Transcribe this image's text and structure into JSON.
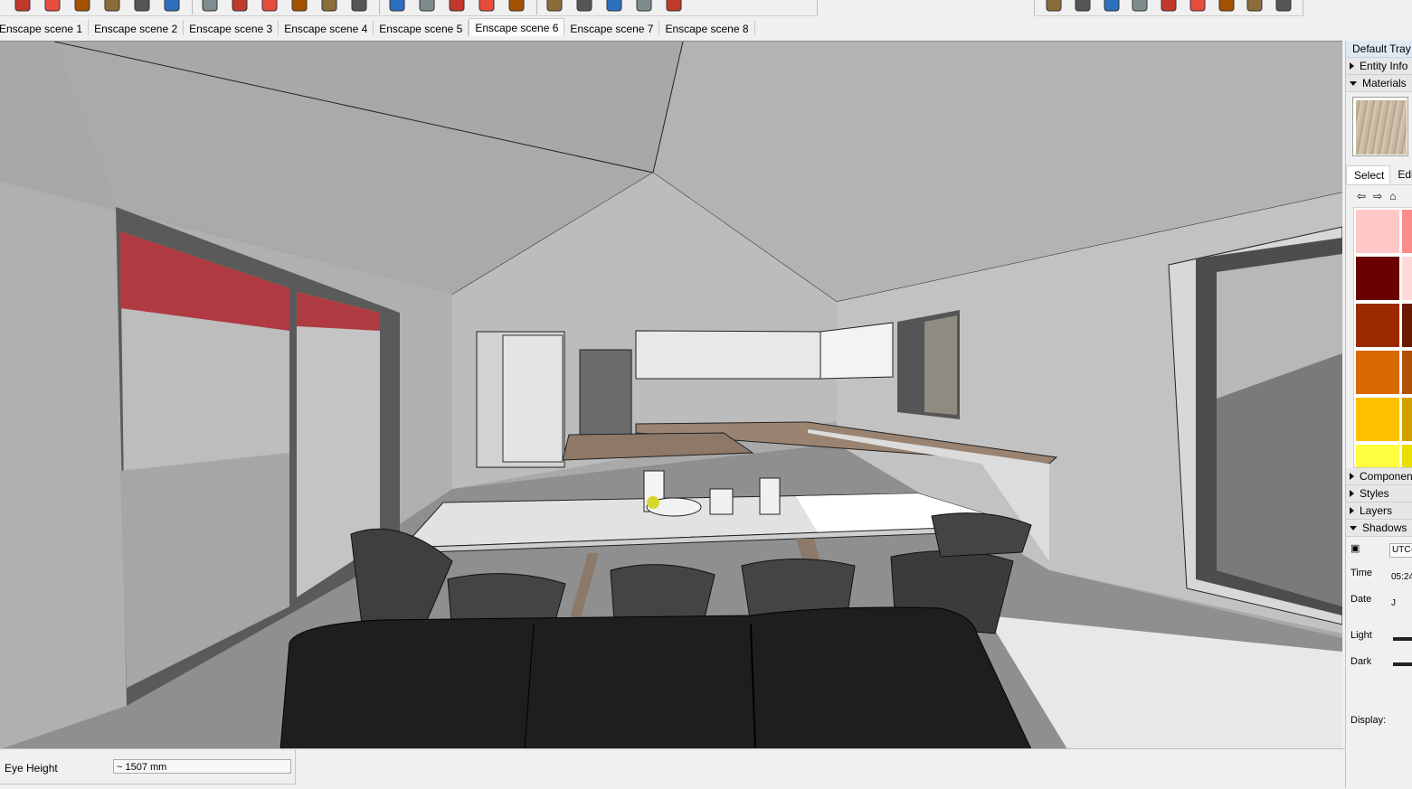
{
  "toolbar": {
    "left_tools": [
      "select-tool",
      "eraser-tool",
      "line-tool",
      "arc-tool",
      "rectangle-tool",
      "push-pull-tool",
      "rotate-tool",
      "move-tool",
      "follow-me-tool",
      "paint-bucket-tool",
      "tape-measure-tool",
      "text-tool",
      "paint-tool",
      "orbit-tool",
      "pan-tool",
      "zoom-tool",
      "zoom-extents-tool",
      "warehouse-tool",
      "extension-tool",
      "share-tool",
      "ruby-tool",
      "account-tool"
    ],
    "right_tools": [
      "walk-tool",
      "position-camera-tool",
      "section-tool",
      "xray-tool",
      "wireframe-tool",
      "hidden-line-tool",
      "shaded-tool",
      "monochrome-tool",
      "interact-tool"
    ]
  },
  "scene_tabs": [
    {
      "label": "Enscape scene 1"
    },
    {
      "label": "Enscape scene 2"
    },
    {
      "label": "Enscape scene 3"
    },
    {
      "label": "Enscape scene 4"
    },
    {
      "label": "Enscape scene 5"
    },
    {
      "label": "Enscape scene 6",
      "active": true
    },
    {
      "label": "Enscape scene 7"
    },
    {
      "label": "Enscape scene 8"
    }
  ],
  "tray": {
    "title": "Default Tray",
    "entity_info": "Entity Info",
    "materials": "Materials",
    "select_tab": "Select",
    "edit_tab": "Edit",
    "components": "Components",
    "styles": "Styles",
    "layers": "Layers",
    "shadows": "Shadows",
    "utc_field": "UTC-",
    "time_label": "Time",
    "time_value": "05:24",
    "date_label": "Date",
    "date_value": "J",
    "light_label": "Light",
    "dark_label": "Dark",
    "display_label": "Display:"
  },
  "material_swatches": [
    "#ffc8c8",
    "#fc8c8c",
    "#6b0000",
    "#ffd8d8",
    "#9b2a00",
    "#6b1a00",
    "#d86800",
    "#b05000",
    "#ffc000",
    "#d0a000",
    "#ffff40",
    "#e8e000"
  ],
  "statusbar": {
    "label": "Eye Height",
    "value": "~ 1507 mm"
  }
}
